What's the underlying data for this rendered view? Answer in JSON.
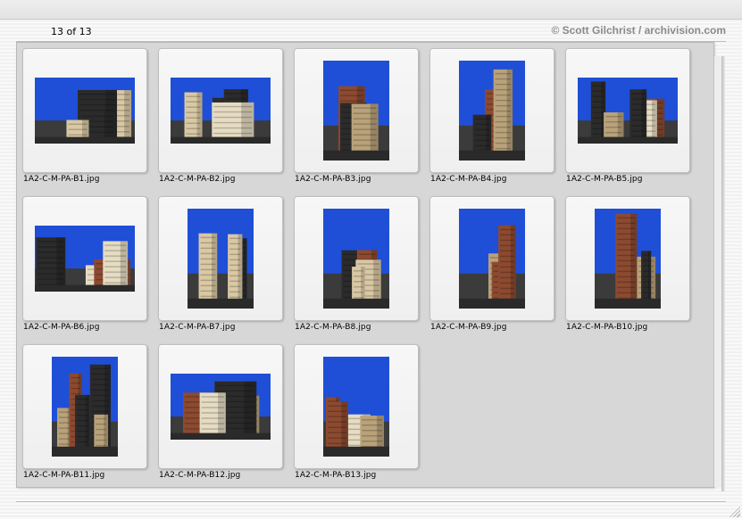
{
  "header": {
    "counter": "13 of 13",
    "credit": "© Scott Gilchrist / archivision.com"
  },
  "items": [
    {
      "filename": "1A2-C-M-PA-B1.jpg",
      "orientation": "landscape"
    },
    {
      "filename": "1A2-C-M-PA-B2.jpg",
      "orientation": "landscape"
    },
    {
      "filename": "1A2-C-M-PA-B3.jpg",
      "orientation": "portrait"
    },
    {
      "filename": "1A2-C-M-PA-B4.jpg",
      "orientation": "portrait"
    },
    {
      "filename": "1A2-C-M-PA-B5.jpg",
      "orientation": "landscape"
    },
    {
      "filename": "1A2-C-M-PA-B6.jpg",
      "orientation": "landscape"
    },
    {
      "filename": "1A2-C-M-PA-B7.jpg",
      "orientation": "portrait"
    },
    {
      "filename": "1A2-C-M-PA-B8.jpg",
      "orientation": "portrait"
    },
    {
      "filename": "1A2-C-M-PA-B9.jpg",
      "orientation": "portrait"
    },
    {
      "filename": "1A2-C-M-PA-B10.jpg",
      "orientation": "portrait"
    },
    {
      "filename": "1A2-C-M-PA-B11.jpg",
      "orientation": "portrait"
    },
    {
      "filename": "1A2-C-M-PA-B12.jpg",
      "orientation": "landscape"
    },
    {
      "filename": "1A2-C-M-PA-B13.jpg",
      "orientation": "portrait"
    }
  ],
  "colors": {
    "sky": "#1f4fd6",
    "building_light": "#d9c8a4",
    "building_brick": "#8c4a30",
    "building_dark": "#2b2b2b"
  }
}
